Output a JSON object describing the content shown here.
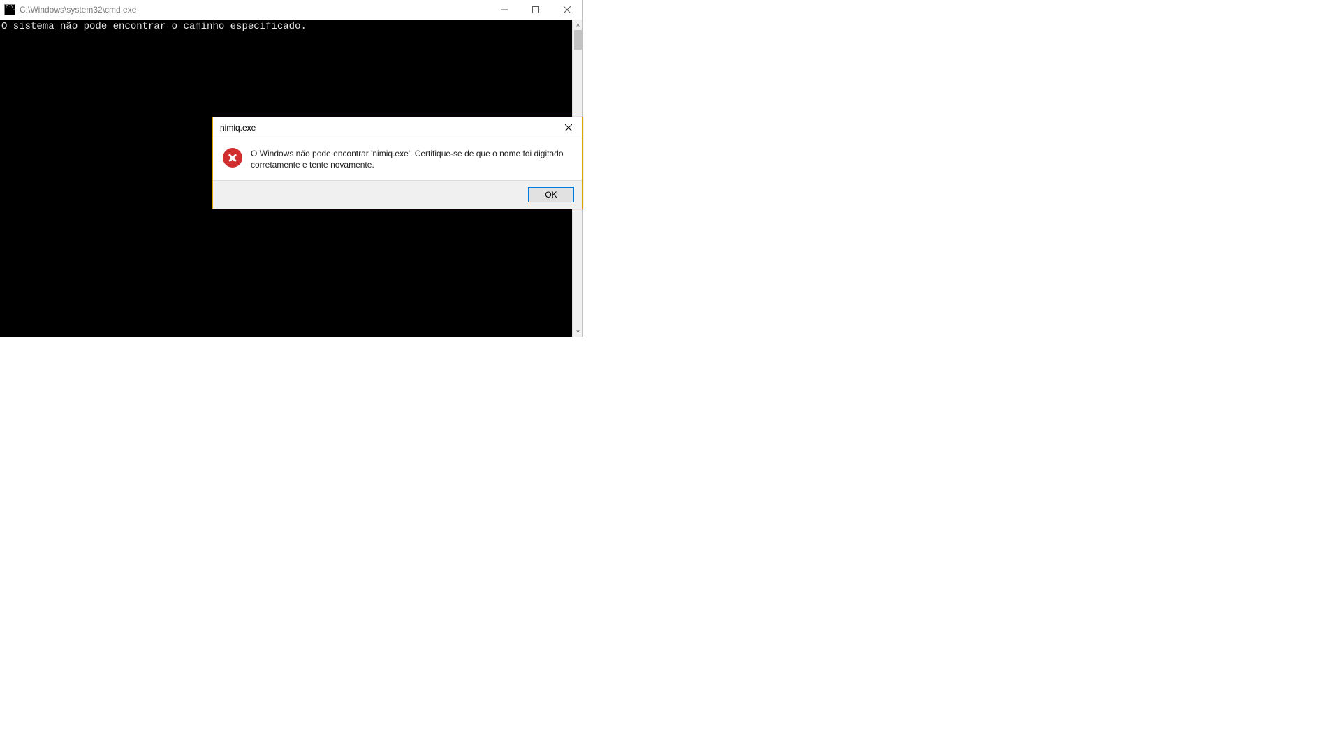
{
  "cmd": {
    "title": "C:\\Windows\\system32\\cmd.exe",
    "output_line1": "O sistema não pode encontrar o caminho especificado."
  },
  "dialog": {
    "title": "nimiq.exe",
    "message": "O Windows não pode encontrar 'nimiq.exe'. Certifique-se de que o nome foi digitado corretamente e tente novamente.",
    "ok_label": "OK"
  }
}
